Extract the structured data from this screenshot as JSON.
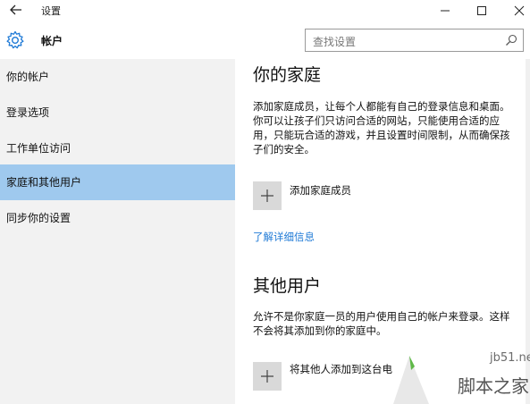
{
  "window": {
    "title": "设置"
  },
  "header": {
    "section_title": "帐户",
    "search_placeholder": "查找设置"
  },
  "sidebar": {
    "items": [
      {
        "label": "你的帐户"
      },
      {
        "label": "登录选项"
      },
      {
        "label": "工作单位访问"
      },
      {
        "label": "家庭和其他用户",
        "active": true
      },
      {
        "label": "同步你的设置"
      }
    ]
  },
  "main": {
    "family": {
      "heading": "你的家庭",
      "description": "添加家庭成员，让每个人都能有自己的登录信息和桌面。你可以让孩子们只访问合适的网站，只能使用合适的应用，只能玩合适的游戏，并且设置时间限制，从而确保孩子们的安全。",
      "add_label": "添加家庭成员",
      "link": "了解详细信息"
    },
    "others": {
      "heading": "其他用户",
      "description": "允许不是你家庭一员的用户使用自己的帐户来登录。这样不会将其添加到你的家庭中。",
      "add_label": "将其他人添加到这台电"
    }
  },
  "watermark": {
    "domain": "jb51.net",
    "name": "脚本之家"
  },
  "colors": {
    "accent": "#1f7ad6",
    "active_nav": "#9fc9ee",
    "sidebar_bg": "#f2f2f2",
    "button_bg": "#d9d9d9"
  }
}
